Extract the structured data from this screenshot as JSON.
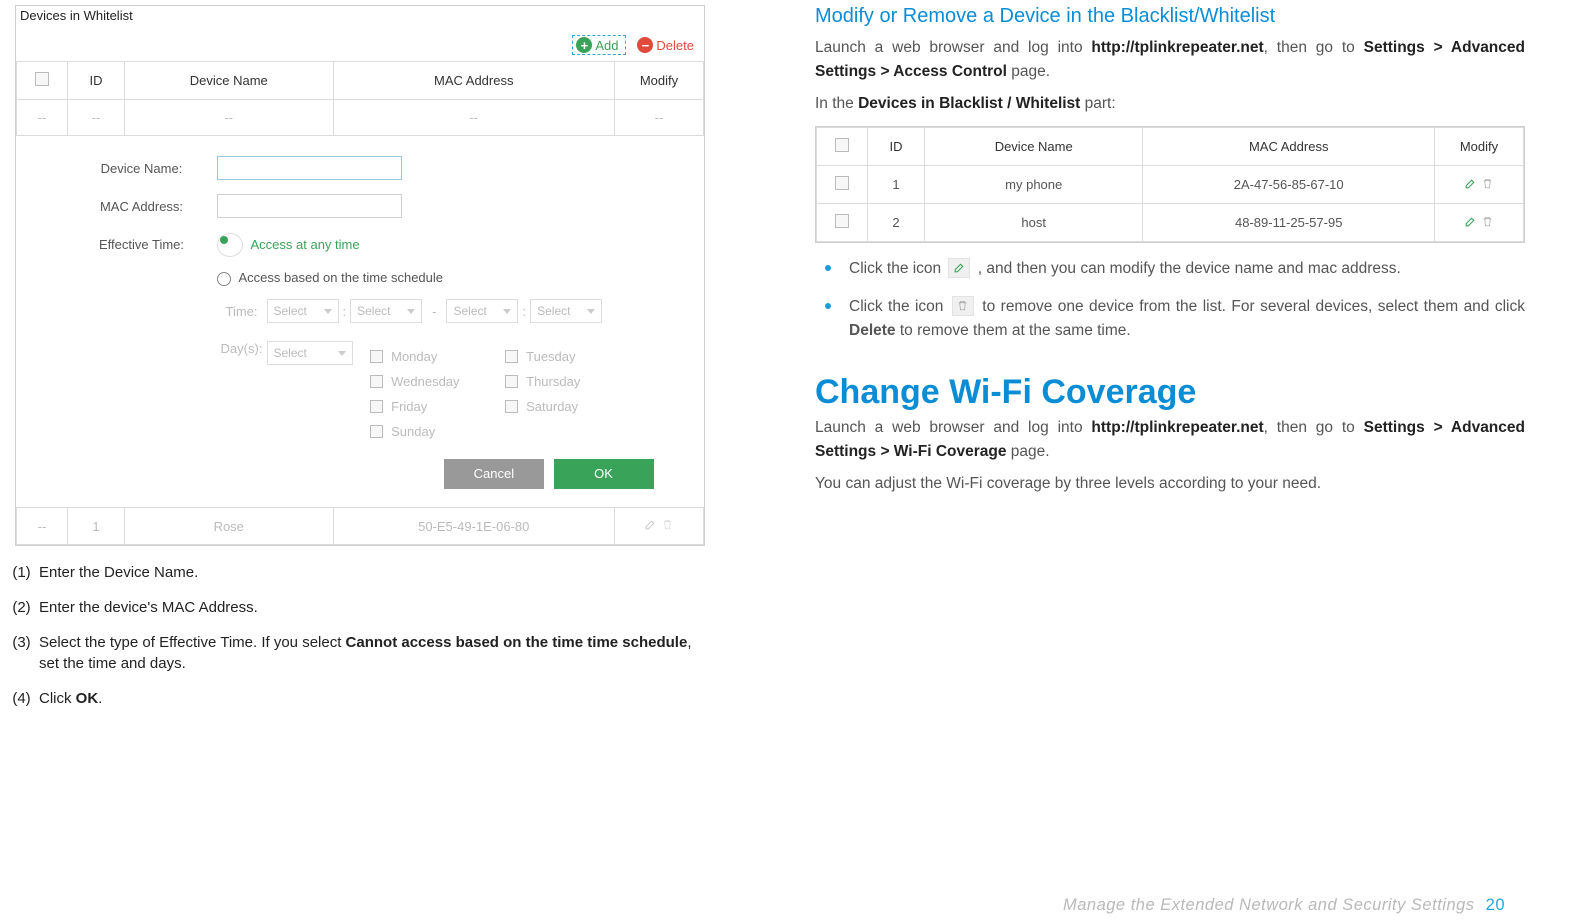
{
  "left_panel": {
    "title": "Devices in Whitelist",
    "add_label": "Add",
    "del_label": "Delete",
    "cols": {
      "id": "ID",
      "name": "Device Name",
      "mac": "MAC Address",
      "modify": "Modify"
    },
    "placeholder_dash": "--",
    "form": {
      "device_name_label": "Device Name:",
      "mac_label": "MAC Address:",
      "eff_label": "Effective Time:",
      "opt1": "Access at any time",
      "opt2": "Access based on the time schedule",
      "time_label": "Time:",
      "select_ph": "Select",
      "days_label": "Day(s):",
      "days": [
        "Monday",
        "Tuesday",
        "Wednesday",
        "Thursday",
        "Friday",
        "Saturday",
        "Sunday"
      ],
      "cancel": "Cancel",
      "ok": "OK"
    },
    "footrow": {
      "id": "1",
      "name": "Rose",
      "mac": "50-E5-49-1E-06-80"
    }
  },
  "left_steps": {
    "s1": "Enter the Device Name.",
    "s2": "Enter the device's MAC Address.",
    "s3_a": "Select the type of Effective Time. If you select ",
    "s3_b": "Cannot access based on the time time schedule",
    "s3_c": ", set the time and days.",
    "s4_a": "Click ",
    "s4_b": "OK",
    "s4_c": "."
  },
  "right": {
    "h2": "Modify or Remove a Device in the Blacklist/Whitelist",
    "p1_a": "Launch a web browser and log into ",
    "p1_b": "http://tplinkrepeater.net",
    "p1_c": ", then go to ",
    "p1_d": "Settings > Advanced Settings > Access Control",
    "p1_e": " page.",
    "p2_a": "In the ",
    "p2_b": "Devices in Blacklist / Whitelist",
    "p2_c": " part:",
    "table": {
      "cols": {
        "id": "ID",
        "name": "Device Name",
        "mac": "MAC Address",
        "modify": "Modify"
      },
      "rows": [
        {
          "id": "1",
          "name": "my phone",
          "mac": "2A-47-56-85-67-10"
        },
        {
          "id": "2",
          "name": "host",
          "mac": "48-89-11-25-57-95"
        }
      ]
    },
    "bul1_a": "Click the icon ",
    "bul1_b": ", and then you can modify the device name and mac address.",
    "bul2_a": "Click the icon ",
    "bul2_b": " to remove one device from the list. For several devices, select them and click ",
    "bul2_c": "Delete",
    "bul2_d": " to remove them at the same time.",
    "h1": "Change Wi-Fi Coverage",
    "p3_a": "Launch a web browser and log into ",
    "p3_b": "http://tplinkrepeater.net",
    "p3_c": ", then go to ",
    "p3_d": "Settings > Advanced Settings > Wi-Fi Coverage",
    "p3_e": " page.",
    "p4": "You can adjust the Wi-Fi coverage by three levels according to your need."
  },
  "footer": {
    "text": "Manage the Extended Network and Security Settings",
    "page": "20"
  }
}
